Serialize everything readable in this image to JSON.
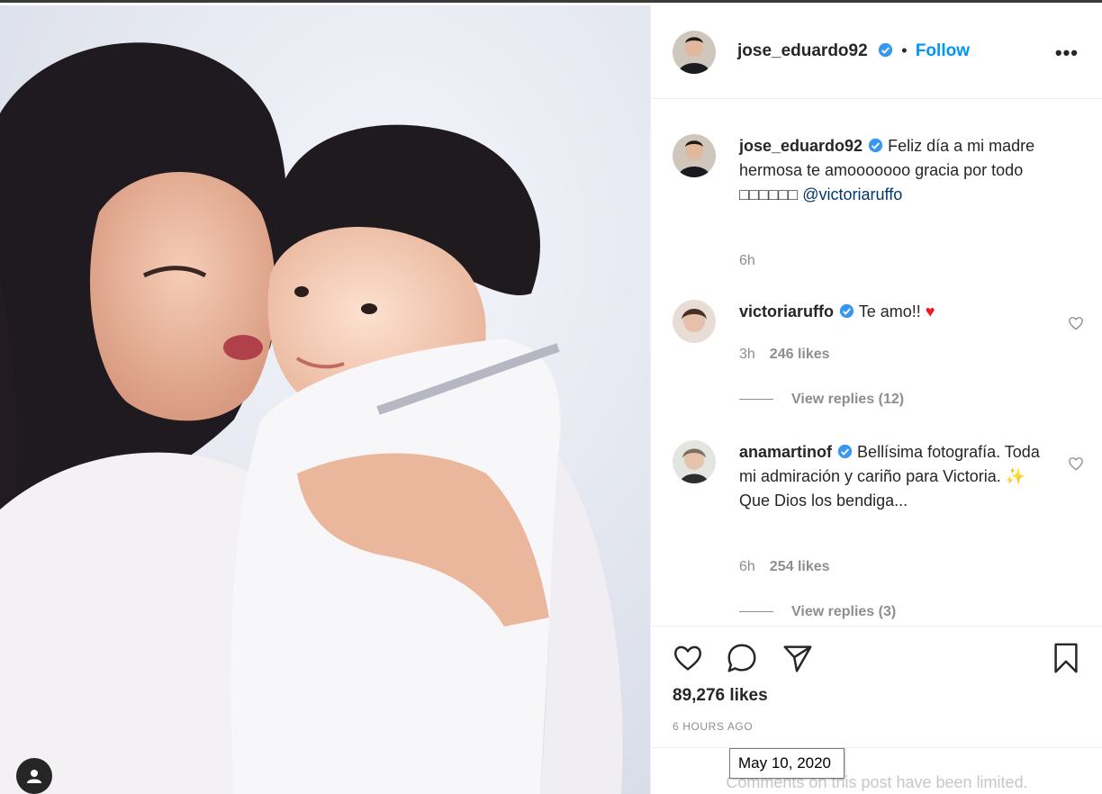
{
  "post": {
    "author": "jose_eduardo92",
    "follow_label": "Follow",
    "more_label": "•••",
    "caption_author": "jose_eduardo92",
    "caption_text": "Feliz día a mi madre hermosa te amooooooo gracia por todo □□□□□□",
    "caption_mention": "@victoriaruffo",
    "caption_time": "6h"
  },
  "comments": [
    {
      "author": "victoriaruffo",
      "text": "Te amo!! ",
      "emoji": "♥",
      "time": "3h",
      "likes": "246 likes",
      "view_replies": "View replies (12)"
    },
    {
      "author": "anamartinof",
      "text": "Bellísima fotografía. Toda mi admiración y cariño para Victoria. ✨ Que Dios los bendiga...",
      "time": "6h",
      "likes": "254 likes",
      "view_replies": "View replies (3)"
    }
  ],
  "footer": {
    "likes": "89,276 likes",
    "time_ago": "6 HOURS AGO",
    "limited_notice": "Comments on this post have been limited."
  },
  "tooltip": {
    "date": "May 10, 2020"
  },
  "colors": {
    "accent": "#0095f6",
    "verified": "#3897f0",
    "heart": "#ed1c24"
  }
}
